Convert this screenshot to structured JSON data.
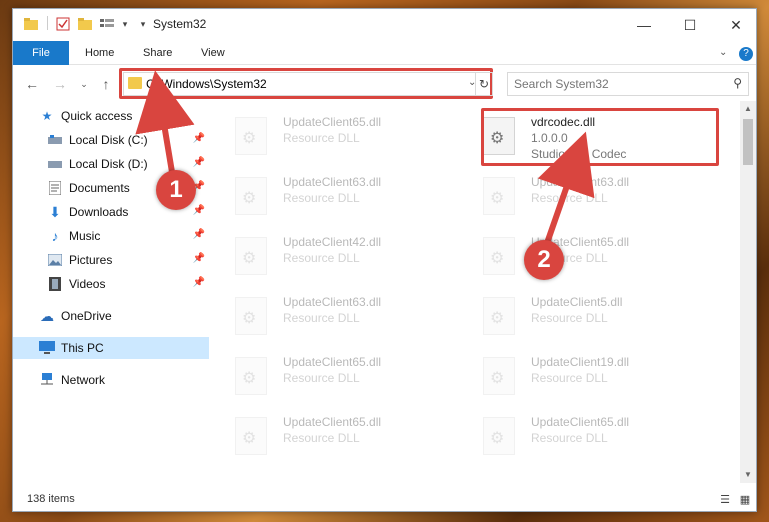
{
  "window": {
    "title": "System32",
    "controls": {
      "minimize": "—",
      "maximize": "☐",
      "close": "✕"
    }
  },
  "ribbon": {
    "tabs": [
      "File",
      "Home",
      "Share",
      "View"
    ],
    "expand_icon": "chevron-down-icon",
    "help_icon": "help-icon"
  },
  "address_bar": {
    "path": "C:\\Windows\\System32",
    "search_placeholder": "Search System32"
  },
  "sidebar": {
    "items": [
      {
        "label": "Quick access",
        "icon": "star-icon",
        "pinned": false
      },
      {
        "label": "Local Disk (C:)",
        "icon": "drive-icon",
        "pinned": true
      },
      {
        "label": "Local Disk (D:)",
        "icon": "drive-icon",
        "pinned": true
      },
      {
        "label": "Documents",
        "icon": "documents-icon",
        "pinned": true
      },
      {
        "label": "Downloads",
        "icon": "download-icon",
        "pinned": true
      },
      {
        "label": "Music",
        "icon": "music-icon",
        "pinned": true
      },
      {
        "label": "Pictures",
        "icon": "pictures-icon",
        "pinned": true
      },
      {
        "label": "Videos",
        "icon": "videos-icon",
        "pinned": true
      },
      {
        "label": "OneDrive",
        "icon": "cloud-icon",
        "pinned": false
      },
      {
        "label": "This PC",
        "icon": "computer-icon",
        "pinned": false,
        "selected": true
      },
      {
        "label": "Network",
        "icon": "network-icon",
        "pinned": false
      }
    ]
  },
  "files": {
    "left_column": [
      {
        "name": "UpdateClient65.dll",
        "type": "Resource DLL"
      },
      {
        "name": "UpdateClient63.dll",
        "type": "Resource DLL"
      },
      {
        "name": "UpdateClient42.dll",
        "type": "Resource DLL"
      },
      {
        "name": "UpdateClient63.dll",
        "type": "Resource DLL"
      },
      {
        "name": "UpdateClient65.dll",
        "type": "Resource DLL"
      },
      {
        "name": "UpdateClient65.dll",
        "type": "Resource DLL"
      }
    ],
    "right_column": [
      {
        "name": "vdrcodec.dll",
        "version": "1.0.0.0",
        "type": "Studio 600 Codec",
        "highlighted": true
      },
      {
        "name": "UpdateClient63.dll",
        "type": "Resource DLL"
      },
      {
        "name": "UpdateClient65.dll",
        "type": "Resource DLL"
      },
      {
        "name": "UpdateClient5.dll",
        "type": "Resource DLL"
      },
      {
        "name": "UpdateClient19.dll",
        "type": "Resource DLL"
      },
      {
        "name": "UpdateClient65.dll",
        "type": "Resource DLL"
      }
    ]
  },
  "status_bar": {
    "item_count": "138 items"
  },
  "annotations": {
    "badge_1": "1",
    "badge_2": "2",
    "color": "#d9453f"
  }
}
